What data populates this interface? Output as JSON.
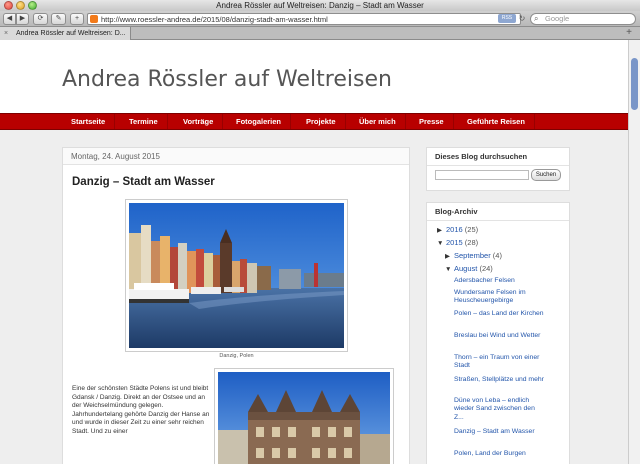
{
  "window": {
    "title": "Andrea Rössler auf Weltreisen: Danzig – Stadt am Wasser"
  },
  "toolbar": {
    "back_icon": "◀",
    "forward_icon": "▶",
    "reload_icon": "⟳",
    "tools_icon": "✎",
    "add_icon": "+",
    "url": "http://www.roessler-andrea.de/2015/08/danzig-stadt-am-wasser.html",
    "rss_label": "RSS",
    "search_placeholder": "Google"
  },
  "tabbar": {
    "tab_label": "Andrea Rössler auf Weltreisen: D..."
  },
  "blog": {
    "title": "Andrea Rössler auf Weltreisen"
  },
  "nav": {
    "items": [
      "Startseite",
      "Termine",
      "Vorträge",
      "Fotogalerien",
      "Projekte",
      "Über mich",
      "Presse",
      "Geführte Reisen"
    ]
  },
  "post": {
    "date": "Montag, 24. August 2015",
    "title": "Danzig – Stadt am Wasser",
    "caption": "Danzig, Polen",
    "text": "Eine der schönsten Städte Polens ist und bleibt Gdansk / Danzig. Direkt an der Ostsee und an der Weichselmündung gelegen. Jahrhundertelang gehörte Danzig der Hanse an und wurde in dieser Zeit zu einer sehr reichen Stadt. Und zu einer"
  },
  "sidebar": {
    "search_title": "Dieses Blog durchsuchen",
    "search_button": "Suchen",
    "archive_title": "Blog-Archiv",
    "y2016": {
      "label": "2016",
      "count": "(25)"
    },
    "y2015": {
      "label": "2015",
      "count": "(28)"
    },
    "september": {
      "label": "September",
      "count": "(4)"
    },
    "august": {
      "label": "August",
      "count": "(24)"
    },
    "posts": [
      "Adersbacher Felsen",
      "Wundersame Felsen im Heuscheuergebirge",
      "Polen – das Land der Kirchen",
      "Breslau bei Wind und Wetter",
      "Thorn – ein Traum von einer Stadt",
      "Straßen, Stellplätze und mehr",
      "Düne von Leba – endlich wieder Sand zwischen den Z...",
      "Danzig – Stadt am Wasser",
      "Polen, Land der Burgen"
    ]
  },
  "colors": {
    "nav_red": "#b80000",
    "link_blue": "#2255aa"
  }
}
